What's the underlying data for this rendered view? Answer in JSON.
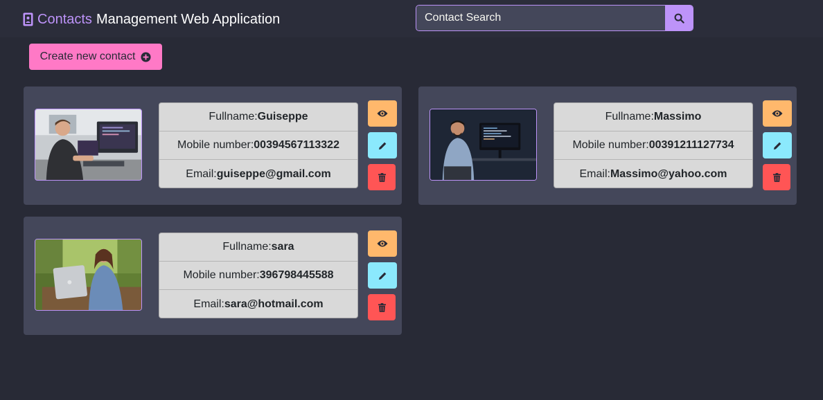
{
  "navbar": {
    "brand_accent": "Contacts",
    "brand_rest": "Management Web Application",
    "search_placeholder": "Contact Search"
  },
  "create_button_label": "Create new contact",
  "labels": {
    "fullname": "Fullname:",
    "mobile": "Mobile number:",
    "email": "Email:"
  },
  "contacts": [
    {
      "fullname": "Guiseppe",
      "mobile": "00394567113322",
      "email": "guiseppe@gmail.com"
    },
    {
      "fullname": "Massimo",
      "mobile": "00391211127734",
      "email": "Massimo@yahoo.com"
    },
    {
      "fullname": "sara",
      "mobile": "396798445588",
      "email": "sara@hotmail.com"
    }
  ],
  "icons": {
    "brand": "address-book-icon",
    "search": "search-icon",
    "create": "plus-circle-icon",
    "view": "eye-icon",
    "edit": "pencil-icon",
    "delete": "trash-icon"
  },
  "colors": {
    "background": "#282a36",
    "accent": "#bd93f9",
    "create": "#ff79c6",
    "view": "#ffb86c",
    "edit": "#8be9fd",
    "delete": "#ff5555"
  }
}
